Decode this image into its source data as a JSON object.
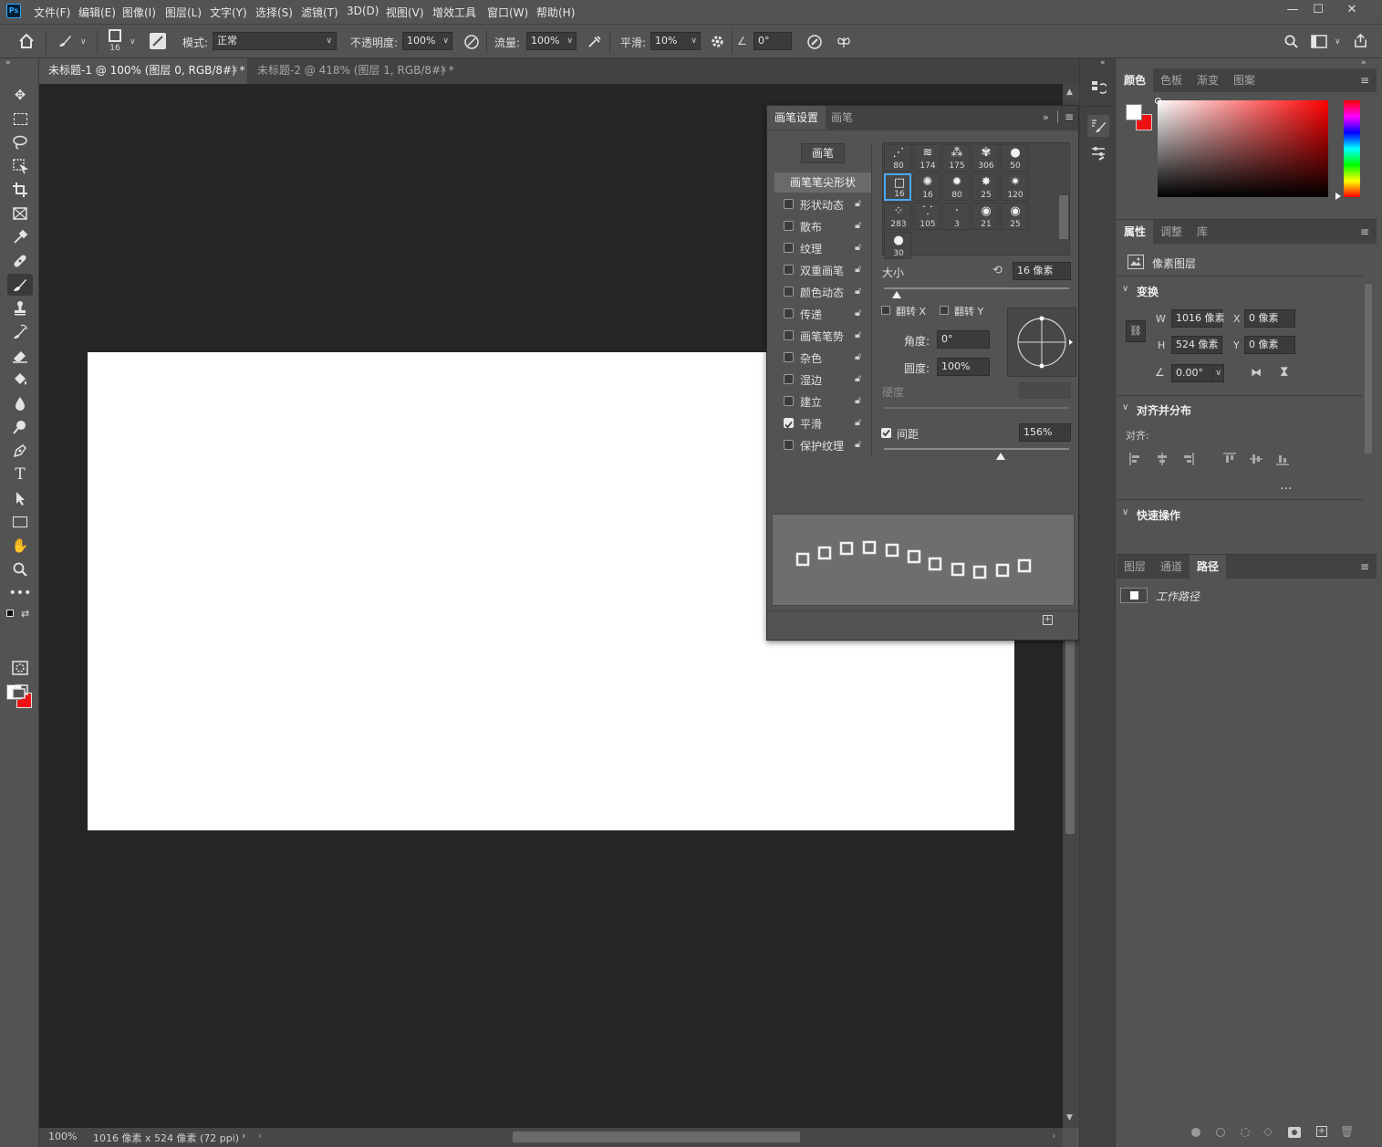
{
  "app": {
    "logo_text": "Ps",
    "menu": [
      "文件(F)",
      "编辑(E)",
      "图像(I)",
      "图层(L)",
      "文字(Y)",
      "选择(S)",
      "滤镜(T)",
      "3D(D)",
      "视图(V)",
      "增效工具",
      "窗口(W)",
      "帮助(H)"
    ],
    "window_controls": [
      "minimize-icon",
      "maximize-icon",
      "close-icon"
    ]
  },
  "options_bar": {
    "brush_size": "16",
    "mode_label": "模式:",
    "mode_value": "正常",
    "opacity_label": "不透明度:",
    "opacity_value": "100%",
    "flow_label": "流量:",
    "flow_value": "100%",
    "smoothing_label": "平滑:",
    "smoothing_value": "10%",
    "angle_value": "0°"
  },
  "tabs": [
    {
      "label": "未标题-1 @ 100% (图层 0, RGB/8#) *",
      "active": true
    },
    {
      "label": "未标题-2 @ 418% (图层 1, RGB/8#) *",
      "active": false
    }
  ],
  "status": {
    "zoom": "100%",
    "doc_info": "1016 像素 x 524 像素 (72 ppi)"
  },
  "brush_settings": {
    "tabs": [
      "画笔设置",
      "画笔"
    ],
    "brushes_button": "画笔",
    "tip_shape_header": "画笔笔尖形状",
    "options": [
      {
        "label": "形状动态",
        "checked": false
      },
      {
        "label": "散布",
        "checked": false
      },
      {
        "label": "纹理",
        "checked": false
      },
      {
        "label": "双重画笔",
        "checked": false
      },
      {
        "label": "颜色动态",
        "checked": false
      },
      {
        "label": "传递",
        "checked": false
      },
      {
        "label": "画笔笔势",
        "checked": false
      },
      {
        "label": "杂色",
        "checked": false
      },
      {
        "label": "湿边",
        "checked": false
      },
      {
        "label": "建立",
        "checked": false
      },
      {
        "label": "平滑",
        "checked": true
      },
      {
        "label": "保护纹理",
        "checked": false
      }
    ],
    "presets": [
      "80",
      "174",
      "175",
      "306",
      "50",
      "16",
      "16",
      "80",
      "25",
      "120",
      "283",
      "105",
      "3",
      "21",
      "25",
      "30"
    ],
    "selected_preset_index": 5,
    "size_label": "大小",
    "size_value": "16 像素",
    "size_fraction": 0.07,
    "flip_x_label": "翻转 X",
    "flip_y_label": "翻转 Y",
    "angle_label": "角度:",
    "angle_value": "0°",
    "roundness_label": "圆度:",
    "roundness_value": "100%",
    "hardness_label": "硬度",
    "spacing_label": "间距",
    "spacing_checked": true,
    "spacing_value": "156%",
    "spacing_fraction": 0.63
  },
  "color_panel": {
    "tabs": [
      "颜色",
      "色板",
      "渐变",
      "图案"
    ],
    "foreground": "#ffffff",
    "background": "#ee1111",
    "hue_color": "#ff0000"
  },
  "properties_panel": {
    "tabs": [
      "属性",
      "调整",
      "库"
    ],
    "layer_type": "像素图层",
    "transform_title": "变换",
    "w_label": "W",
    "w_value": "1016 像素",
    "h_label": "H",
    "h_value": "524 像素",
    "x_label": "X",
    "x_value": "0 像素",
    "y_label": "Y",
    "y_value": "0 像素",
    "angle_value": "0.00°",
    "align_title": "对齐并分布",
    "align_label": "对齐:",
    "more": "...",
    "quick_actions_title": "快速操作"
  },
  "layers_panel": {
    "tabs": [
      "图层",
      "通道",
      "路径"
    ],
    "path_item": "工作路径"
  }
}
